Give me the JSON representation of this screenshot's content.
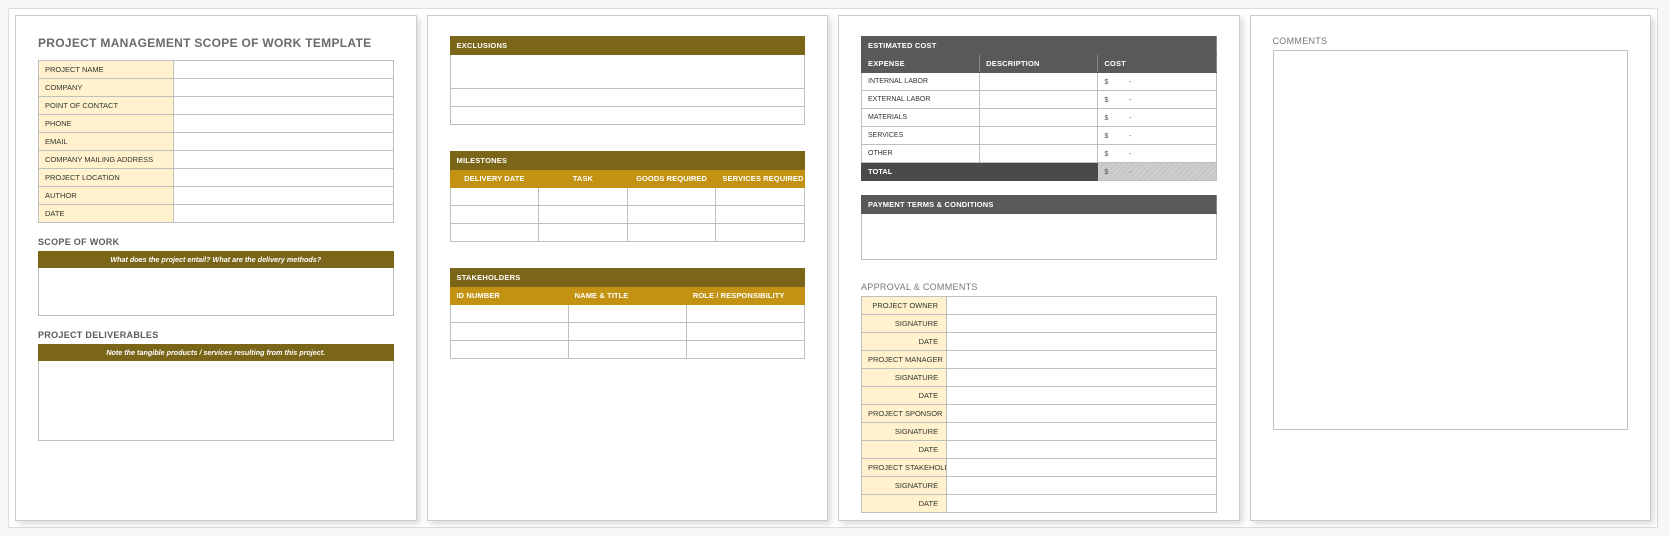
{
  "doc_title": "PROJECT MANAGEMENT SCOPE OF WORK TEMPLATE",
  "page1": {
    "fields": [
      "PROJECT NAME",
      "COMPANY",
      "POINT OF CONTACT",
      "PHONE",
      "EMAIL",
      "COMPANY MAILING ADDRESS",
      "PROJECT LOCATION",
      "AUTHOR",
      "DATE"
    ],
    "scope_title": "SCOPE OF WORK",
    "scope_sub": "What does the project entail? What are the delivery methods?",
    "deliv_title": "PROJECT DELIVERABLES",
    "deliv_sub": "Note the tangible products / services resulting from this project."
  },
  "page2": {
    "exclusions": "EXCLUSIONS",
    "milestones": "MILESTONES",
    "milestone_cols": [
      "DELIVERY DATE",
      "TASK",
      "GOODS REQUIRED",
      "SERVICES REQUIRED"
    ],
    "stakeholders": "STAKEHOLDERS",
    "stakeholder_cols": [
      "ID NUMBER",
      "NAME & TITLE",
      "ROLE / RESPONSIBILITY"
    ]
  },
  "page3": {
    "estcost": "ESTIMATED COST",
    "cost_cols": [
      "EXPENSE",
      "DESCRIPTION",
      "COST"
    ],
    "cost_rows": [
      "INTERNAL LABOR",
      "EXTERNAL LABOR",
      "MATERIALS",
      "SERVICES",
      "OTHER"
    ],
    "total_label": "TOTAL",
    "dollar": "$",
    "dash": "-",
    "payment": "PAYMENT TERMS & CONDITIONS",
    "approval": "APPROVAL & COMMENTS",
    "approval_rows": [
      "PROJECT OWNER",
      "SIGNATURE",
      "DATE",
      "PROJECT MANAGER",
      "SIGNATURE",
      "DATE",
      "PROJECT SPONSOR",
      "SIGNATURE",
      "DATE",
      "PROJECT STAKEHOLDER",
      "SIGNATURE",
      "DATE"
    ]
  },
  "page4": {
    "comments": "COMMENTS"
  }
}
